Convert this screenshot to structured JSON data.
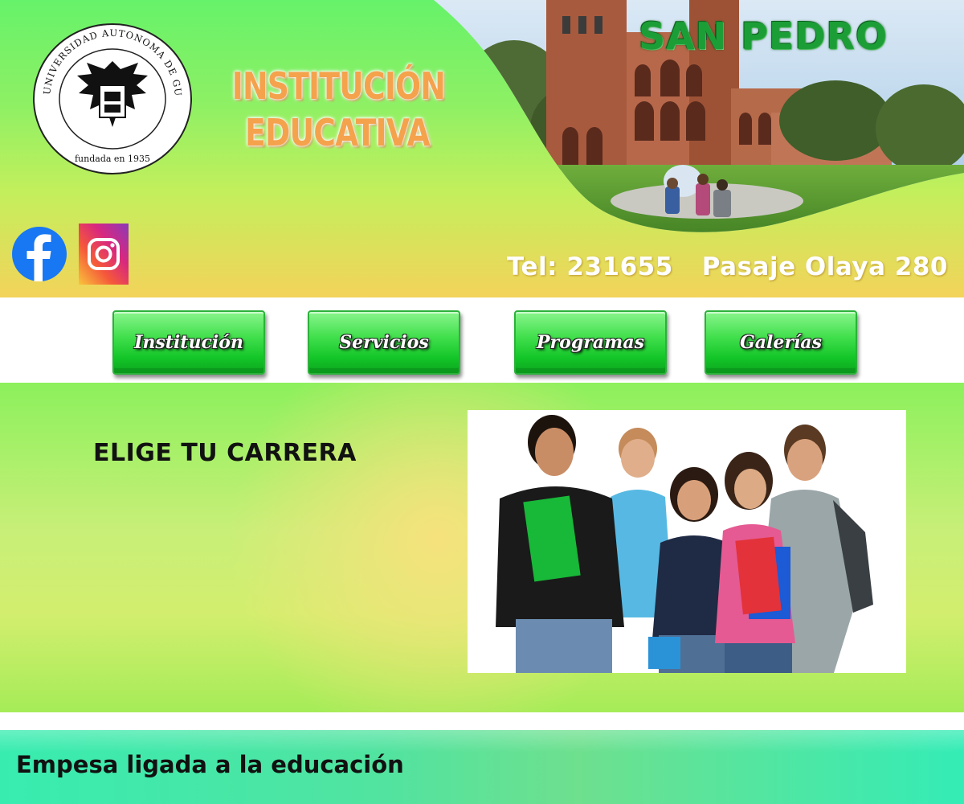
{
  "header": {
    "logo": {
      "ring_text": "UNIVERSIDAD AUTONOMA DE GUADALAJARA",
      "founded_text": "fundada en 1935"
    },
    "title_line1": "INSTITUCIÓN",
    "title_line2": "EDUCATIVA",
    "campus_name": "SAN PEDRO",
    "phone": "Tel: 231655",
    "address": "Pasaje Olaya 280",
    "social": [
      {
        "name": "facebook",
        "icon": "facebook-icon",
        "color": "#1877f2"
      },
      {
        "name": "instagram",
        "icon": "instagram-icon",
        "color": "#dd2a7b"
      }
    ]
  },
  "nav": {
    "items": [
      {
        "label": "Institución"
      },
      {
        "label": "Servicios"
      },
      {
        "label": "Programas"
      },
      {
        "label": "Galerías"
      }
    ]
  },
  "main": {
    "section_title": "ELIGE TU CARRERA"
  },
  "footer": {
    "text": "Empesa ligada a la educación"
  },
  "colors": {
    "header_green": "#66f26a",
    "header_yellow": "#f3d35a",
    "title_orange": "#f5a24d",
    "campus_green": "#1c9e37",
    "button_green": "#13c628",
    "footer_teal": "#38ecb0"
  }
}
